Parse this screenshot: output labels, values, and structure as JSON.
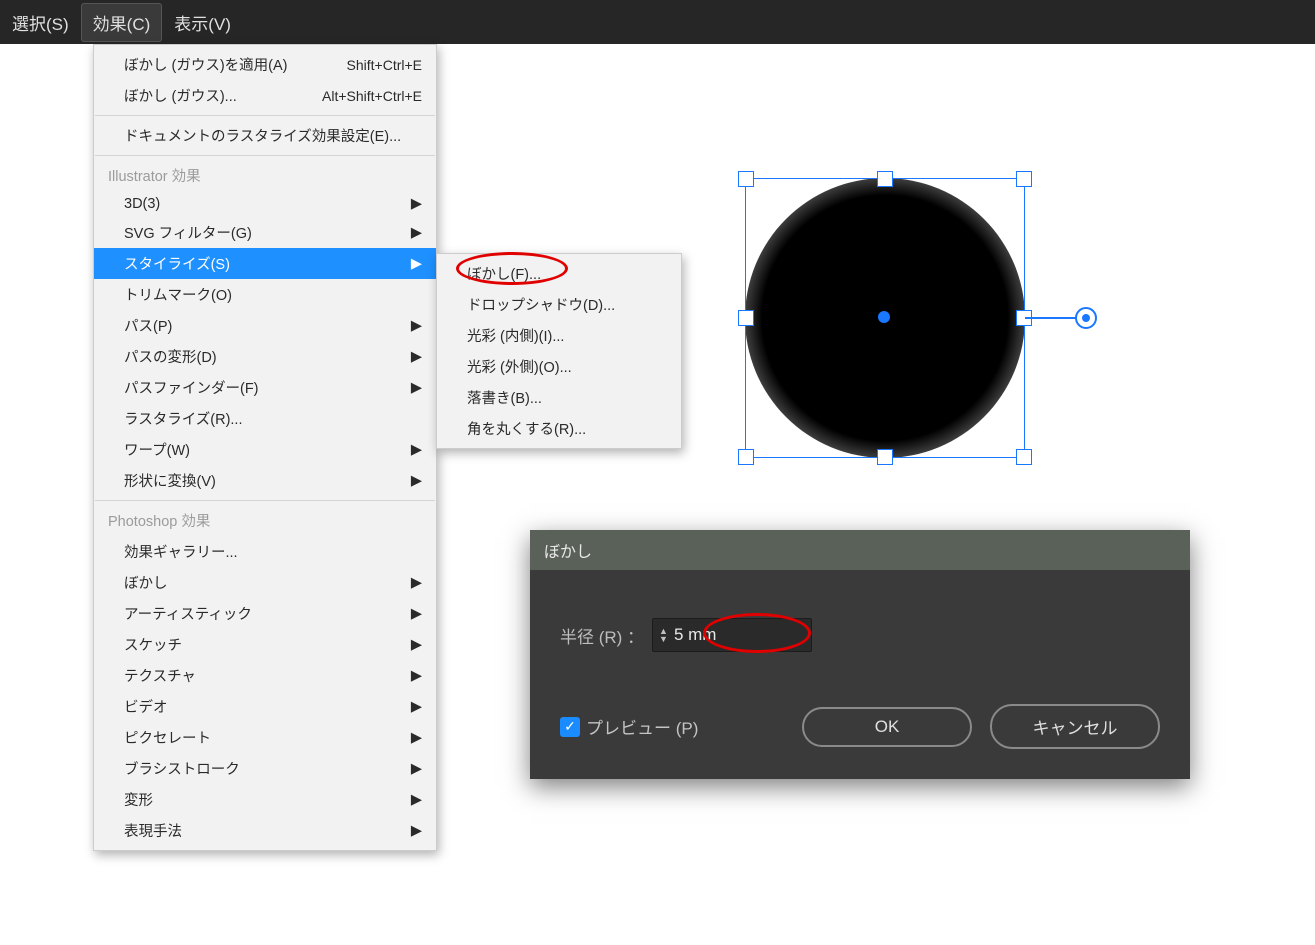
{
  "menubar": {
    "select": "選択(S)",
    "effect": "効果(C)",
    "view": "表示(V)"
  },
  "menu": {
    "apply_blur": "ぼかし (ガウス)を適用(A)",
    "apply_blur_shortcut": "Shift+Ctrl+E",
    "blur_gauss": "ぼかし (ガウス)...",
    "blur_gauss_shortcut": "Alt+Shift+Ctrl+E",
    "doc_raster": "ドキュメントのラスタライズ効果設定(E)...",
    "illustrator_header": "Illustrator 効果",
    "threeD": "3D(3)",
    "svg_filter": "SVG フィルター(G)",
    "stylize": "スタイライズ(S)",
    "trim_marks": "トリムマーク(O)",
    "path": "パス(P)",
    "path_distort": "パスの変形(D)",
    "pathfinder": "パスファインダー(F)",
    "rasterize": "ラスタライズ(R)...",
    "warp": "ワープ(W)",
    "convert_shape": "形状に変換(V)",
    "photoshop_header": "Photoshop 効果",
    "effect_gallery": "効果ギャラリー...",
    "blur": "ぼかし",
    "artistic": "アーティスティック",
    "sketch": "スケッチ",
    "texture": "テクスチャ",
    "video": "ビデオ",
    "pixelate": "ピクセレート",
    "brush_strokes": "ブラシストローク",
    "distort": "変形",
    "render": "表現手法"
  },
  "submenu": {
    "blur_f": "ぼかし(F)...",
    "drop_shadow": "ドロップシャドウ(D)...",
    "inner_glow": "光彩 (内側)(I)...",
    "outer_glow": "光彩 (外側)(O)...",
    "scribble": "落書き(B)...",
    "round_corners": "角を丸くする(R)..."
  },
  "dialog": {
    "title": "ぼかし",
    "radius_label": "半径 (R) ：",
    "radius_value": "5 mm",
    "preview_label": "プレビュー (P)",
    "ok": "OK",
    "cancel": "キャンセル"
  }
}
